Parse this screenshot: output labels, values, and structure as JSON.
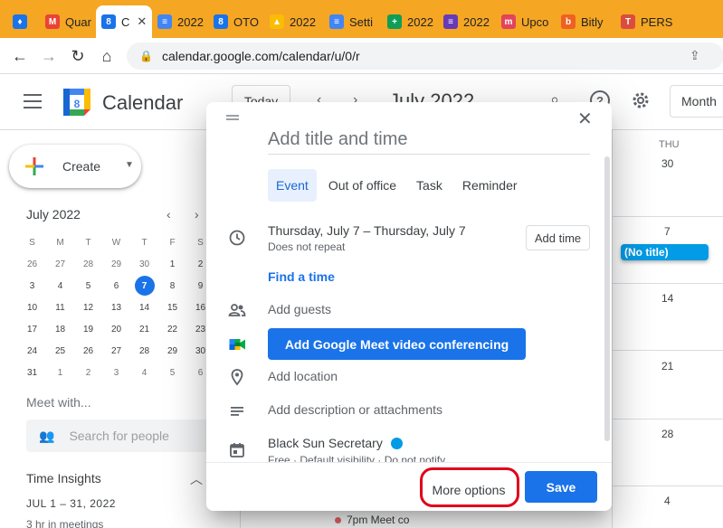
{
  "browser": {
    "tabs": [
      {
        "label": "",
        "favicon": "vivaldi-icon",
        "color": "#1a73e8",
        "glyph": "♦"
      },
      {
        "label": "Quar",
        "favicon": "gmail-icon",
        "color": "#ea4335",
        "glyph": "M"
      },
      {
        "label": "C",
        "favicon": "calendar-icon",
        "color": "#1a73e8",
        "glyph": "8",
        "active": true
      },
      {
        "label": "2022",
        "favicon": "docs-icon",
        "color": "#4285f4",
        "glyph": "≡"
      },
      {
        "label": "OTO",
        "favicon": "calendar-icon",
        "color": "#1a73e8",
        "glyph": "8"
      },
      {
        "label": "2022",
        "favicon": "drive-icon",
        "color": "#fbbc04",
        "glyph": "▲"
      },
      {
        "label": "Setti",
        "favicon": "docs-icon",
        "color": "#4285f4",
        "glyph": "≡"
      },
      {
        "label": "2022",
        "favicon": "sheets-icon",
        "color": "#0f9d58",
        "glyph": "+"
      },
      {
        "label": "2022",
        "favicon": "forms-icon",
        "color": "#673ab7",
        "glyph": "≡"
      },
      {
        "label": "Upco",
        "favicon": "monday-icon",
        "color": "#e2445c",
        "glyph": "m"
      },
      {
        "label": "Bitly",
        "favicon": "bitly-icon",
        "color": "#ee6123",
        "glyph": "b"
      },
      {
        "label": "PERS",
        "favicon": "todoist-icon",
        "color": "#db4c3f",
        "glyph": "T"
      }
    ],
    "url": "calendar.google.com/calendar/u/0/r"
  },
  "header": {
    "app_title": "Calendar",
    "today_label": "Today",
    "month_title": "July 2022",
    "view_label": "Month"
  },
  "sidebar": {
    "create_label": "Create",
    "mini_month": "July 2022",
    "days_of_week": [
      "S",
      "M",
      "T",
      "W",
      "T",
      "F",
      "S"
    ],
    "weeks": [
      [
        "26",
        "27",
        "28",
        "29",
        "30",
        "1",
        "2"
      ],
      [
        "3",
        "4",
        "5",
        "6",
        "7",
        "8",
        "9"
      ],
      [
        "10",
        "11",
        "12",
        "13",
        "14",
        "15",
        "16"
      ],
      [
        "17",
        "18",
        "19",
        "20",
        "21",
        "22",
        "23"
      ],
      [
        "24",
        "25",
        "26",
        "27",
        "28",
        "29",
        "30"
      ],
      [
        "31",
        "1",
        "2",
        "3",
        "4",
        "5",
        "6"
      ]
    ],
    "today": "7",
    "meet_with": "Meet with...",
    "search_placeholder": "Search for people",
    "insights_title": "Time Insights",
    "insights_range": "JUL 1 – 31, 2022",
    "insights_meetings": "3 hr in meetings"
  },
  "grid": {
    "column_header": "THU",
    "dates": [
      "30",
      "7",
      "14",
      "21",
      "28",
      "4"
    ],
    "event_label": "(No title)",
    "bottom_event": "7pm Meet co"
  },
  "dialog": {
    "title_placeholder": "Add title and time",
    "tabs": [
      "Event",
      "Out of office",
      "Task",
      "Reminder"
    ],
    "date_range": "Thursday, July 7   –   Thursday, July 7",
    "repeat": "Does not repeat",
    "add_time": "Add time",
    "find_time": "Find a time",
    "add_guests": "Add guests",
    "meet_button": "Add Google Meet video conferencing",
    "add_location": "Add location",
    "add_description": "Add description or attachments",
    "calendar_name": "Black Sun Secretary",
    "calendar_color": "#039be5",
    "calendar_meta": "Free · Default visibility · Do not notify",
    "more_options": "More options",
    "save": "Save"
  }
}
